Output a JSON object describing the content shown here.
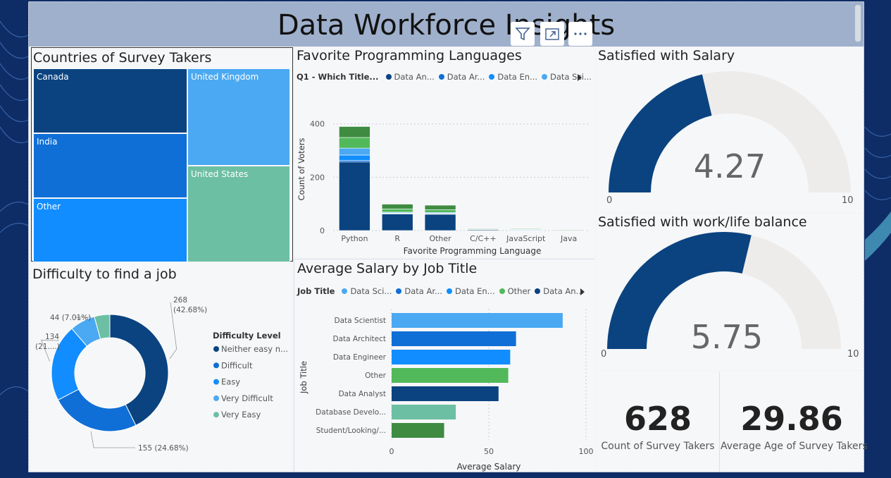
{
  "report": {
    "title": "Data Workforce Insights"
  },
  "visual_header": {
    "icons": [
      "filter-icon",
      "focus-mode-icon",
      "more-options-icon"
    ]
  },
  "colors": {
    "navy": "#0a4380",
    "blue": "#0f6fd6",
    "brightblue": "#118dff",
    "lightblue": "#4aa9f2",
    "teal": "#6dbfa3",
    "green": "#52b95a",
    "darkgreen": "#3e8b41",
    "gauge_track": "#eeecea"
  },
  "treemap": {
    "title": "Countries of Survey Takers",
    "cells": [
      "Canada",
      "India",
      "Other",
      "United Kingdom",
      "United States"
    ]
  },
  "stacked_bar": {
    "title": "Favorite Programming Languages",
    "legend_title": "Q1 - Which Title...",
    "legend_items": [
      "Data An...",
      "Data Ar...",
      "Data En...",
      "Data Sci..."
    ],
    "more_icon": "chevron-right-icon"
  },
  "gauge_salary": {
    "title": "Satisfied with Salary",
    "value_label": "4.27",
    "min_label": "0",
    "max_label": "10"
  },
  "gauge_balance": {
    "title": "Satisfied with work/life balance",
    "value_label": "5.75",
    "min_label": "0",
    "max_label": "10"
  },
  "donut": {
    "title": "Difficulty to find a job"
  },
  "hbar": {
    "title": "Average Salary by Job Title",
    "legend_title": "Job Title",
    "legend_items": [
      "Data Sci...",
      "Data Ar...",
      "Data En...",
      "Other",
      "Data An..."
    ],
    "more_icon": "chevron-right-icon"
  },
  "cards": {
    "count": {
      "value": "628",
      "label": "Count of Survey Takers"
    },
    "age": {
      "value": "29.86",
      "label": "Average Age of Survey Takers"
    }
  },
  "chart_data": [
    {
      "type": "treemap",
      "title": "Countries of Survey Takers",
      "categories": [
        "Canada",
        "India",
        "Other",
        "United Kingdom",
        "United States"
      ]
    },
    {
      "type": "bar",
      "stacked": true,
      "title": "Favorite Programming Languages",
      "xlabel": "Favorite Programming Language",
      "ylabel": "Count of Voters",
      "legend_title": "Q1 - Which Title...",
      "categories": [
        "Python",
        "R",
        "Other",
        "C/C++",
        "JavaScript",
        "Java"
      ],
      "ylim": [
        0,
        460
      ],
      "yticks": [
        "0",
        "200",
        "400"
      ],
      "grid": true,
      "legend": "top",
      "series": [
        {
          "name": "Data An...",
          "values": [
            257,
            62,
            61,
            4,
            2,
            1
          ]
        },
        {
          "name": "Data Ar...",
          "values": [
            6,
            2,
            2,
            0,
            0,
            0
          ]
        },
        {
          "name": "Data En...",
          "values": [
            20,
            2,
            2,
            1,
            1,
            0
          ]
        },
        {
          "name": "Data Sci...",
          "values": [
            26,
            3,
            3,
            1,
            0,
            0
          ]
        },
        {
          "values": [
            40,
            12,
            10,
            1,
            2,
            1
          ]
        },
        {
          "values": [
            41,
            18,
            17,
            1,
            2,
            1
          ]
        }
      ]
    },
    {
      "type": "gauge",
      "title": "Satisfied with Salary",
      "value": 4.27,
      "min": 0,
      "max": 10
    },
    {
      "type": "gauge",
      "title": "Satisfied with work/life balance",
      "value": 5.75,
      "min": 0,
      "max": 10
    },
    {
      "type": "pie",
      "donut": true,
      "title": "Difficulty to find a job",
      "legend_title": "Difficulty Level",
      "legend": "right",
      "categories": [
        "Neither easy n...",
        "Difficult",
        "Easy",
        "Very Difficult",
        "Very Easy"
      ],
      "values": [
        268,
        155,
        134,
        44,
        27
      ],
      "data_labels": [
        "268 (42.68%)",
        "155 (24.68%)",
        "134 (21....)",
        "44 (7.01%)"
      ]
    },
    {
      "type": "bar",
      "orientation": "horizontal",
      "title": "Average Salary by Job Title",
      "xlabel": "Average Salary",
      "ylabel": "Job Title",
      "legend_title": "Job Title",
      "categories": [
        "Data Scientist",
        "Data Architect",
        "Data Engineer",
        "Other",
        "Data Analyst",
        "Database Develo...",
        "Student/Looking/..."
      ],
      "values": [
        88,
        64,
        61,
        60,
        55,
        33,
        27
      ],
      "xlim": [
        0,
        100
      ],
      "xticks": [
        "0",
        "50",
        "100"
      ],
      "grid": true
    }
  ]
}
